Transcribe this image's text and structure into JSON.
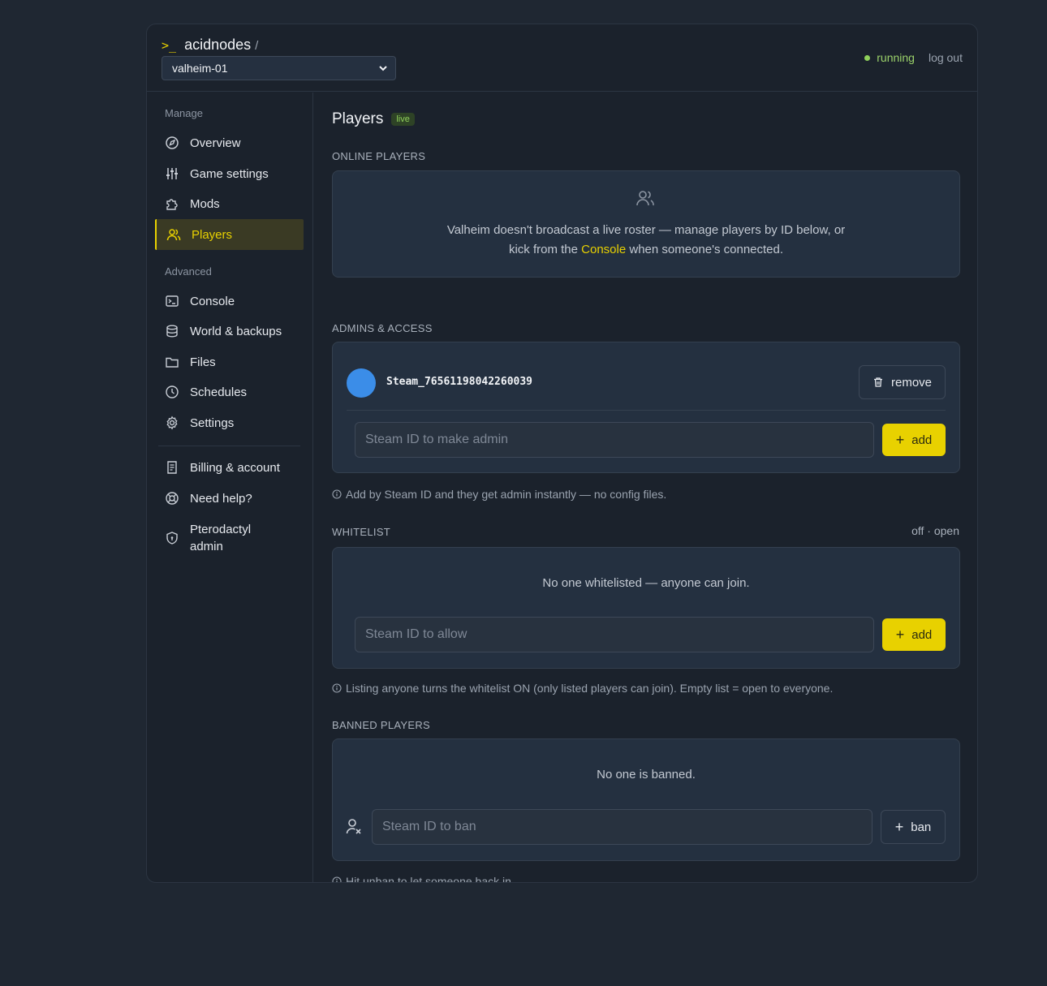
{
  "header": {
    "prompt": ">_",
    "brand": "acidnodes",
    "slash": "/",
    "server": "valheim-01",
    "status": "running",
    "logout": "log out"
  },
  "sidebar": {
    "manage_label": "Manage",
    "advanced_label": "Advanced",
    "items": [
      {
        "label": "Overview",
        "icon": "compass-icon"
      },
      {
        "label": "Game settings",
        "icon": "sliders-icon"
      },
      {
        "label": "Mods",
        "icon": "puzzle-icon"
      },
      {
        "label": "Players",
        "icon": "users-icon",
        "active": true
      },
      {
        "label": "Console",
        "icon": "terminal-icon"
      },
      {
        "label": "World & backups",
        "icon": "database-icon"
      },
      {
        "label": "Files",
        "icon": "folder-icon"
      },
      {
        "label": "Schedules",
        "icon": "clock-icon"
      },
      {
        "label": "Settings",
        "icon": "gear-icon"
      },
      {
        "label": "Billing & account",
        "icon": "receipt-icon"
      },
      {
        "label": "Need help?",
        "icon": "lifebuoy-icon"
      },
      {
        "label": "Pterodactyl admin",
        "icon": "shield-icon"
      }
    ]
  },
  "main": {
    "title": "Players",
    "badge": "live",
    "online": {
      "label": "ONLINE PLAYERS",
      "line1": "Valheim doesn't broadcast a live roster — manage players by ID below, or",
      "line2_pre": "kick from the ",
      "line2_link": "Console",
      "line2_post": " when someone's connected."
    },
    "admins": {
      "label": "ADMINS & ACCESS",
      "admin_id": "Steam_76561198042260039",
      "remove": "remove",
      "placeholder": "Steam ID to make admin",
      "add": "add",
      "hint": "Add by Steam ID and they get admin instantly — no config files."
    },
    "whitelist": {
      "label": "WHITELIST",
      "state": "off · open",
      "empty": "No one whitelisted — anyone can join.",
      "placeholder": "Steam ID to allow",
      "add": "add",
      "hint": "Listing anyone turns the whitelist ON (only listed players can join). Empty list = open to everyone."
    },
    "banned": {
      "label": "BANNED PLAYERS",
      "empty": "No one is banned.",
      "placeholder": "Steam ID to ban",
      "ban": "ban",
      "hint": "Hit unban to let someone back in."
    }
  },
  "colors": {
    "accent": "#e8d100",
    "status_green": "#8fd05a",
    "background": "#1f2732",
    "avatar": "#3b8de8"
  }
}
